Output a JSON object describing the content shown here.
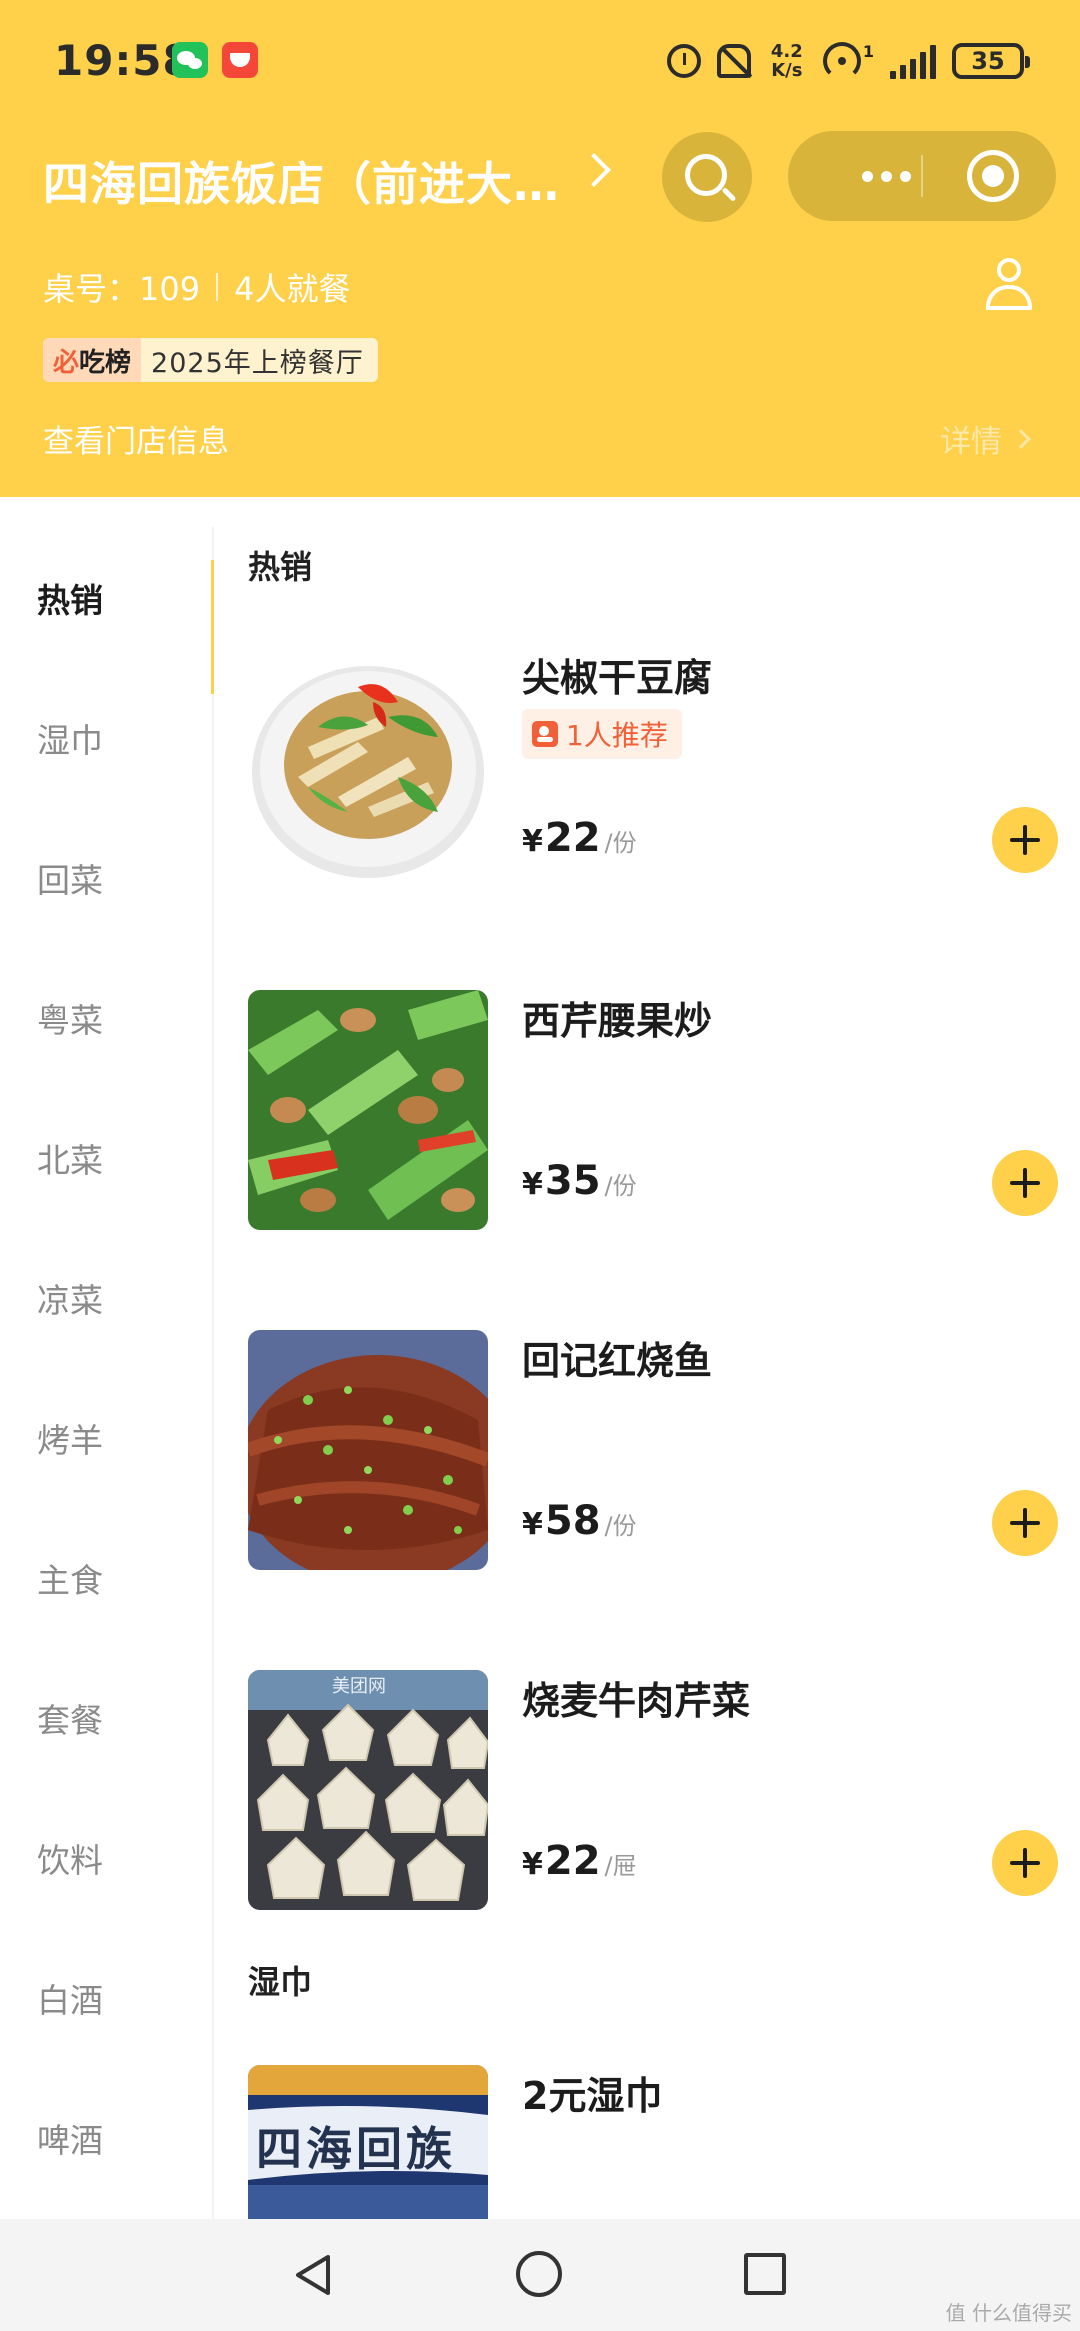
{
  "status_bar": {
    "time": "19:58",
    "net_speed_value": "4.2",
    "net_speed_unit": "K/s",
    "sim_slot": "1",
    "battery": "35"
  },
  "header": {
    "store_name": "四海回族饭店（前进大…",
    "table_label": "桌号：109",
    "diners": "4人就餐",
    "badge_logo_strike": "必",
    "badge_logo_rest": "吃榜",
    "badge_text": "2025年上榜餐厅",
    "store_info_link": "查看门店信息",
    "details_link": "详情"
  },
  "sidebar": {
    "categories": [
      {
        "label": "热销",
        "active": true
      },
      {
        "label": "湿巾"
      },
      {
        "label": "回菜"
      },
      {
        "label": "粤菜"
      },
      {
        "label": "北菜"
      },
      {
        "label": "凉菜"
      },
      {
        "label": "烤羊"
      },
      {
        "label": "主食"
      },
      {
        "label": "套餐"
      },
      {
        "label": "饮料"
      },
      {
        "label": "白酒"
      },
      {
        "label": "啤酒"
      }
    ]
  },
  "sections": [
    {
      "title": "热销",
      "dishes": [
        {
          "name": "尖椒干豆腐",
          "recommendation": "1人推荐",
          "currency": "¥",
          "price": "22",
          "unit": "/份"
        },
        {
          "name": "西芹腰果炒",
          "currency": "¥",
          "price": "35",
          "unit": "/份"
        },
        {
          "name": "回记红烧鱼",
          "currency": "¥",
          "price": "58",
          "unit": "/份"
        },
        {
          "name": "烧麦牛肉芹菜",
          "currency": "¥",
          "price": "22",
          "unit": "/屉",
          "image_caption": "美团网"
        }
      ]
    },
    {
      "title": "湿巾",
      "dishes": [
        {
          "name": "2元湿巾",
          "image_caption": "四海回族"
        }
      ]
    }
  ],
  "watermark": "值 什么值得买",
  "colors": {
    "brand_yellow": "#FFD04A",
    "recommend_orange": "#F0613A"
  }
}
